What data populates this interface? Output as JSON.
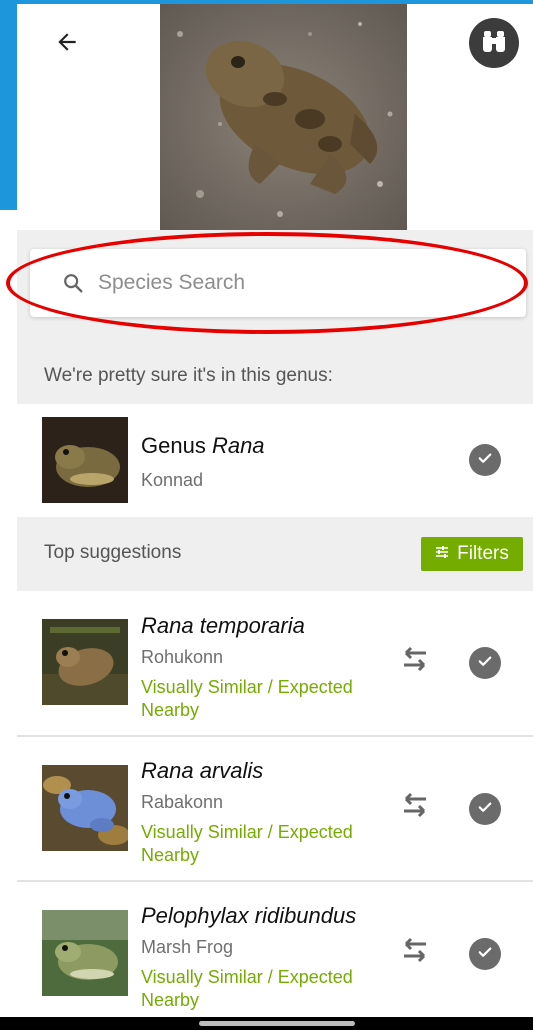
{
  "search": {
    "placeholder": "Species Search"
  },
  "genus_section": {
    "heading": "We're pretty sure it's in this genus:",
    "item": {
      "title_prefix": "Genus",
      "title_italic": "Rana",
      "subtitle": "Konnad"
    }
  },
  "suggestions": {
    "heading": "Top suggestions",
    "filters_label": "Filters",
    "items": [
      {
        "name": "Rana temporaria",
        "common": "Rohukonn",
        "tag": "Visually Similar / Expected Nearby"
      },
      {
        "name": "Rana arvalis",
        "common": "Rabakonn",
        "tag": "Visually Similar / Expected Nearby"
      },
      {
        "name": "Pelophylax ridibundus",
        "common": "Marsh Frog",
        "tag": "Visually Similar / Expected Nearby"
      }
    ]
  },
  "icons": {
    "back": "arrow-left-icon",
    "explore": "binoculars-icon",
    "search": "magnifier-icon",
    "compare": "swap-arrows-icon",
    "select": "check-circle-icon",
    "filters": "sliders-icon"
  },
  "colors": {
    "accent_green": "#74ac00",
    "highlight_red": "#e60000",
    "top_blue": "#1e96dc"
  }
}
